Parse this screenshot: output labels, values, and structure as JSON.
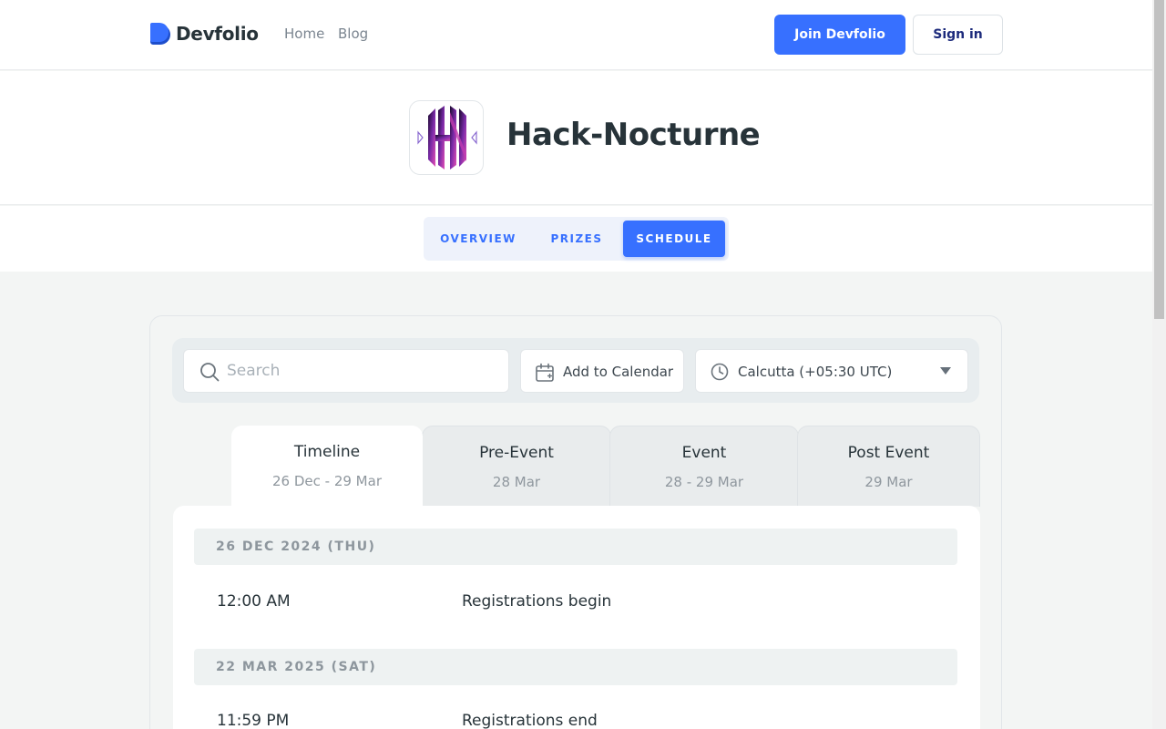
{
  "header": {
    "brand": "Devfolio",
    "nav": [
      {
        "label": "Home"
      },
      {
        "label": "Blog"
      }
    ],
    "join_label": "Join Devfolio",
    "signin_label": "Sign in"
  },
  "hackathon": {
    "title": "Hack-Nocturne",
    "logo_text": "HN"
  },
  "tabs": [
    {
      "label": "OVERVIEW",
      "active": false
    },
    {
      "label": "PRIZES",
      "active": false
    },
    {
      "label": "SCHEDULE",
      "active": true
    }
  ],
  "toolbar": {
    "search_placeholder": "Search",
    "search_value": "",
    "add_calendar_label": "Add to Calendar",
    "timezone_selected": "Calcutta (+05:30 UTC)"
  },
  "phases": [
    {
      "name": "Timeline",
      "dates": "26 Dec - 29 Mar",
      "active": true
    },
    {
      "name": "Pre-Event",
      "dates": "28 Mar",
      "active": false
    },
    {
      "name": "Event",
      "dates": "28 - 29 Mar",
      "active": false
    },
    {
      "name": "Post Event",
      "dates": "29 Mar",
      "active": false
    }
  ],
  "schedule": [
    {
      "date": "26 DEC 2024 (THU)",
      "events": [
        {
          "time": "12:00 AM",
          "title": "Registrations begin"
        }
      ]
    },
    {
      "date": "22 MAR 2025 (SAT)",
      "events": [
        {
          "time": "11:59 PM",
          "title": "Registrations end"
        }
      ]
    }
  ],
  "colors": {
    "accent": "#3770ff",
    "text_dark": "#273339",
    "page_bg": "#f3f5f4"
  }
}
